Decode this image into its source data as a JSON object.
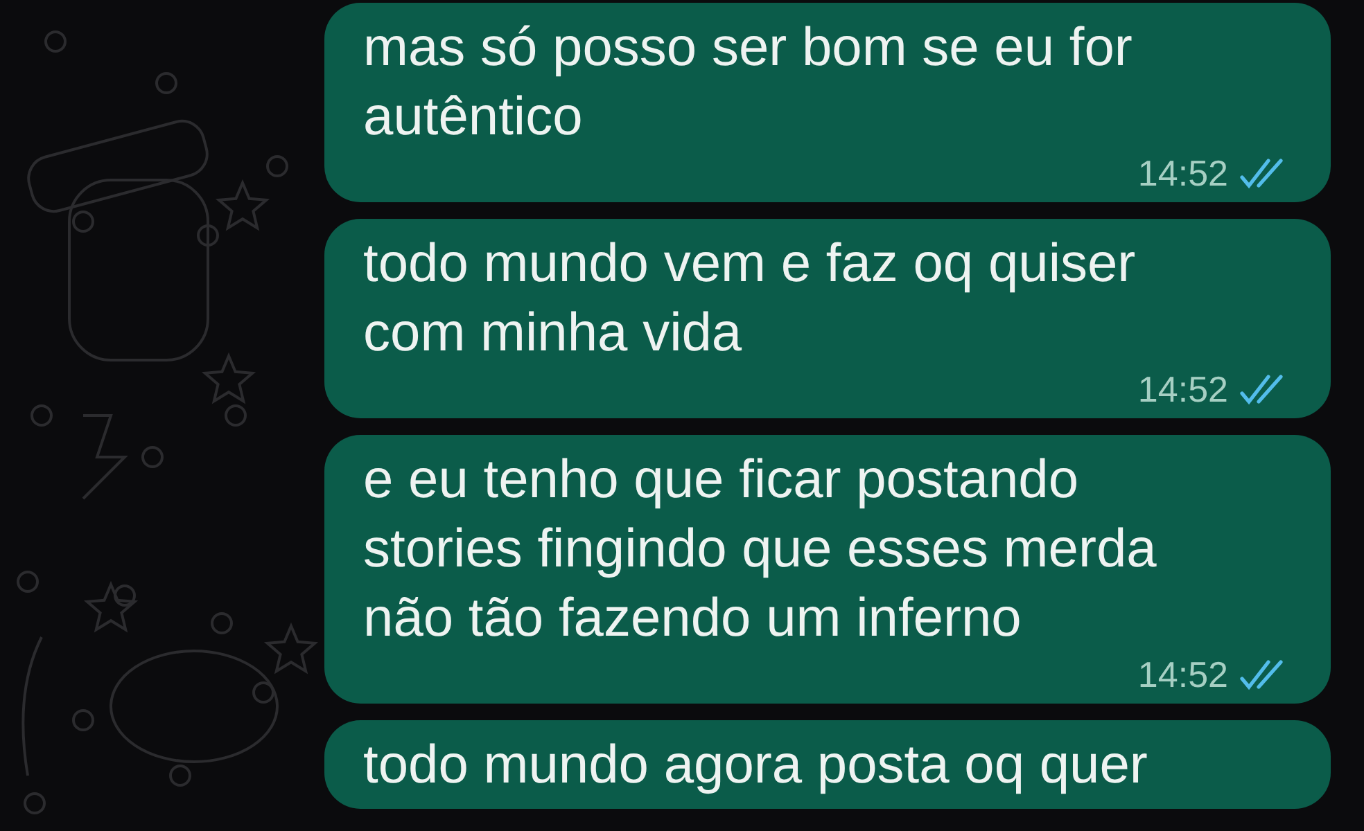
{
  "messages": [
    {
      "text": "mas só posso ser bom se eu for\nautêntico",
      "time": "14:52",
      "read": true
    },
    {
      "text": "todo mundo vem e faz oq quiser\ncom minha vida",
      "time": "14:52",
      "read": true
    },
    {
      "text": "e eu tenho que ficar postando\nstories fingindo que esses merda\nnão tão fazendo um inferno",
      "time": "14:52",
      "read": true
    },
    {
      "text": "todo mundo agora posta oq quer"
    }
  ]
}
